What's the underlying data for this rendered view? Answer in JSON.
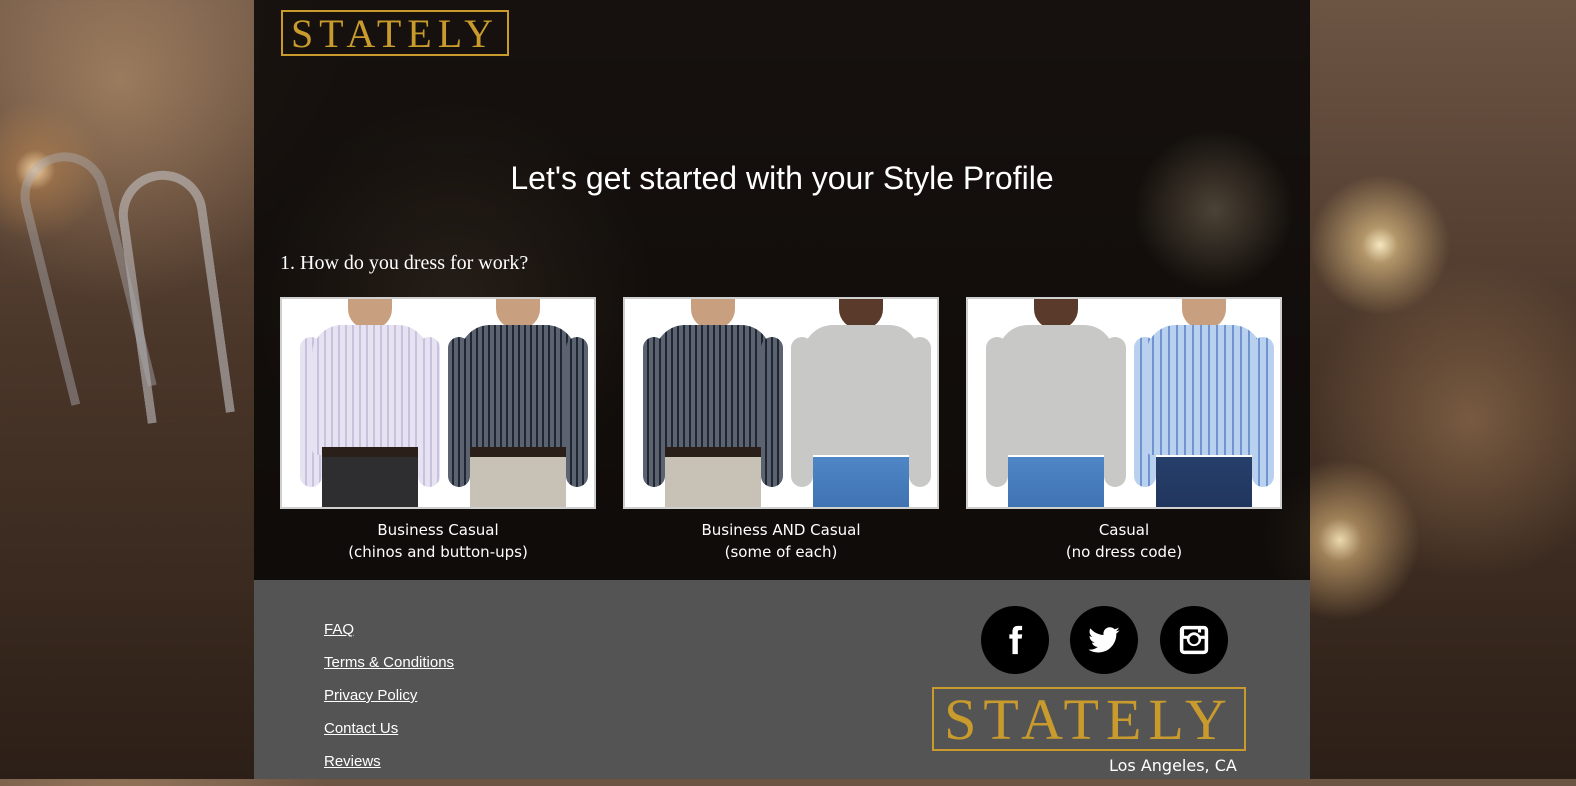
{
  "header": {
    "logo_text": "STATELY"
  },
  "main": {
    "heading": "Let's get started with your Style Profile",
    "question": "1. How do you dress for work?",
    "options": [
      {
        "line1": "Business Casual",
        "line2": "(chinos and button-ups)"
      },
      {
        "line1": "Business AND Casual",
        "line2": "(some of each)"
      },
      {
        "line1": "Casual",
        "line2": "(no dress code)"
      }
    ]
  },
  "footer": {
    "links": [
      "FAQ",
      "Terms & Conditions",
      "Privacy Policy",
      "Contact Us",
      "Reviews"
    ],
    "social_icons": [
      "facebook-icon",
      "twitter-icon",
      "instagram-icon"
    ],
    "logo_text": "STATELY",
    "location": "Los Angeles, CA"
  },
  "colors": {
    "brand_gold": "#c89b2c",
    "footer_bg": "#545454",
    "panel_bg": "#0a0807"
  }
}
